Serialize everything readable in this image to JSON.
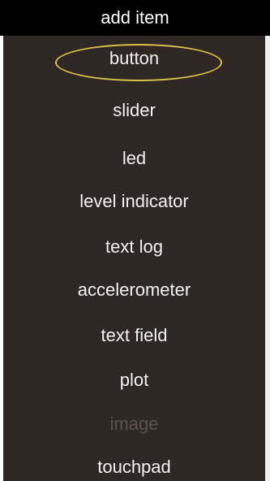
{
  "header": {
    "title": "add item"
  },
  "menu": {
    "items": [
      {
        "label": "button",
        "highlighted": true,
        "enabled": true
      },
      {
        "label": "slider",
        "enabled": true
      },
      {
        "label": "led",
        "enabled": true
      },
      {
        "label": "level indicator",
        "enabled": true
      },
      {
        "label": "text log",
        "enabled": true
      },
      {
        "label": "accelerometer",
        "enabled": true
      },
      {
        "label": "text field",
        "enabled": true
      },
      {
        "label": "plot",
        "enabled": true
      },
      {
        "label": "image",
        "enabled": false
      },
      {
        "label": "touchpad",
        "enabled": true
      }
    ]
  },
  "colors": {
    "background": "#2f2724",
    "header_background": "#000000",
    "text": "#f2f2f2",
    "disabled_text": "#5b5350",
    "highlight_ring": "#d8c34a"
  }
}
